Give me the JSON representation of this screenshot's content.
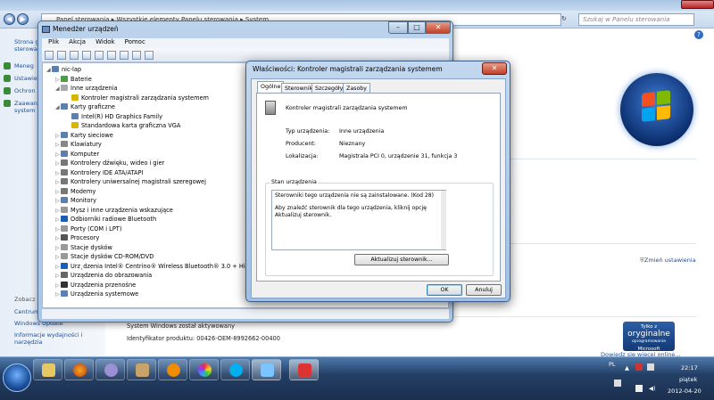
{
  "control_panel": {
    "breadcrumb": [
      "Panel sterowania",
      "Wszystkie elementy Panelu sterowania",
      "System"
    ],
    "search_placeholder": "Szukaj w Panelu sterowania",
    "left_links": [
      "Strona g",
      "sterowa",
      "Meneg",
      "Ustawie",
      "Ochron",
      "Zaawan",
      "system"
    ],
    "see_also": "Zobacz",
    "centrum": "Centrum",
    "windows_update": "Windows Update",
    "perf_link_1": "Informacje wydajności i",
    "perf_link_2": "narzędzia",
    "change_settings": "Zmień ustawienia",
    "activation": "System Windows został aktywowany",
    "product_id": "Identyfikator produktu: 00426-OEM-8992662-00400",
    "genuine_line1": "Tylko z",
    "genuine_line2": "oryginalne",
    "genuine_line3": "oprogramowanie",
    "genuine_line4": "Microsoft",
    "more_online": "Dowiedz się więcej online..."
  },
  "device_manager": {
    "title": "Menedżer urządzeń",
    "menu": [
      "Plik",
      "Akcja",
      "Widok",
      "Pomoc"
    ],
    "tree": [
      {
        "label": "nic-lap",
        "level": 0,
        "expanded": true
      },
      {
        "label": "Baterie",
        "level": 1
      },
      {
        "label": "Inne urządzenia",
        "level": 1,
        "expanded": true
      },
      {
        "label": "Kontroler magistrali zarządzania systemem",
        "level": 2
      },
      {
        "label": "Karty graficzne",
        "level": 1,
        "expanded": true
      },
      {
        "label": "Intel(R) HD Graphics Family",
        "level": 2
      },
      {
        "label": "Standardowa karta graficzna VGA",
        "level": 2
      },
      {
        "label": "Karty sieciowe",
        "level": 1
      },
      {
        "label": "Klawiatury",
        "level": 1
      },
      {
        "label": "Komputer",
        "level": 1
      },
      {
        "label": "Kontrolery dźwięku, wideo i gier",
        "level": 1
      },
      {
        "label": "Kontrolery IDE ATA/ATAPI",
        "level": 1
      },
      {
        "label": "Kontrolery uniwersalnej magistrali szeregowej",
        "level": 1
      },
      {
        "label": "Modemy",
        "level": 1
      },
      {
        "label": "Monitory",
        "level": 1
      },
      {
        "label": "Mysz i inne urządzenia wskazujące",
        "level": 1
      },
      {
        "label": "Odbiorniki radiowe Bluetooth",
        "level": 1
      },
      {
        "label": "Porty (COM i LPT)",
        "level": 1
      },
      {
        "label": "Procesory",
        "level": 1
      },
      {
        "label": "Stacje dysków",
        "level": 1
      },
      {
        "label": "Stacje dysków CD-ROM/DVD",
        "level": 1
      },
      {
        "label": "Urz˛dzenia Intel® Centrino® Wireless Bluetooth® 3.0 + High",
        "level": 1
      },
      {
        "label": "Urządzenia do obrazowania",
        "level": 1
      },
      {
        "label": "Urządzenia przenośne",
        "level": 1
      },
      {
        "label": "Urządzenia systemowe",
        "level": 1
      }
    ]
  },
  "properties": {
    "title": "Właściwości: Kontroler magistrali zarządzania systemem",
    "tabs": [
      "Ogólne",
      "Sterownik",
      "Szczegóły",
      "Zasoby"
    ],
    "device_name": "Kontroler magistrali zarządzania systemem",
    "type_label": "Typ urządzenia:",
    "type_value": "Inne urządzenia",
    "producer_label": "Producent:",
    "producer_value": "Nieznany",
    "location_label": "Lokalizacja:",
    "location_value": "Magistrala PCI 0, urządzenie 31, funkcja 3",
    "status_group": "Stan urządzenia",
    "status_line1": "Sterowniki tego urządzenia nie są zainstalowane. (Kod 28)",
    "status_line2": "Aby znaleźć sterownik dla tego urządzenia, kliknij opcję Aktualizuj sterownik.",
    "update_button": "Aktualizuj sterownik...",
    "ok_button": "OK",
    "cancel_button": "Anuluj"
  },
  "taskbar": {
    "apps": [
      "explorer-icon",
      "firefox-icon",
      "app-icon",
      "game-icon",
      "vlc-icon",
      "picasa-icon",
      "skype-icon",
      "control-panel-icon",
      "device-manager-icon"
    ],
    "lang": "PL",
    "time": "22:17",
    "day": "piątek",
    "date": "2012-04-20"
  }
}
